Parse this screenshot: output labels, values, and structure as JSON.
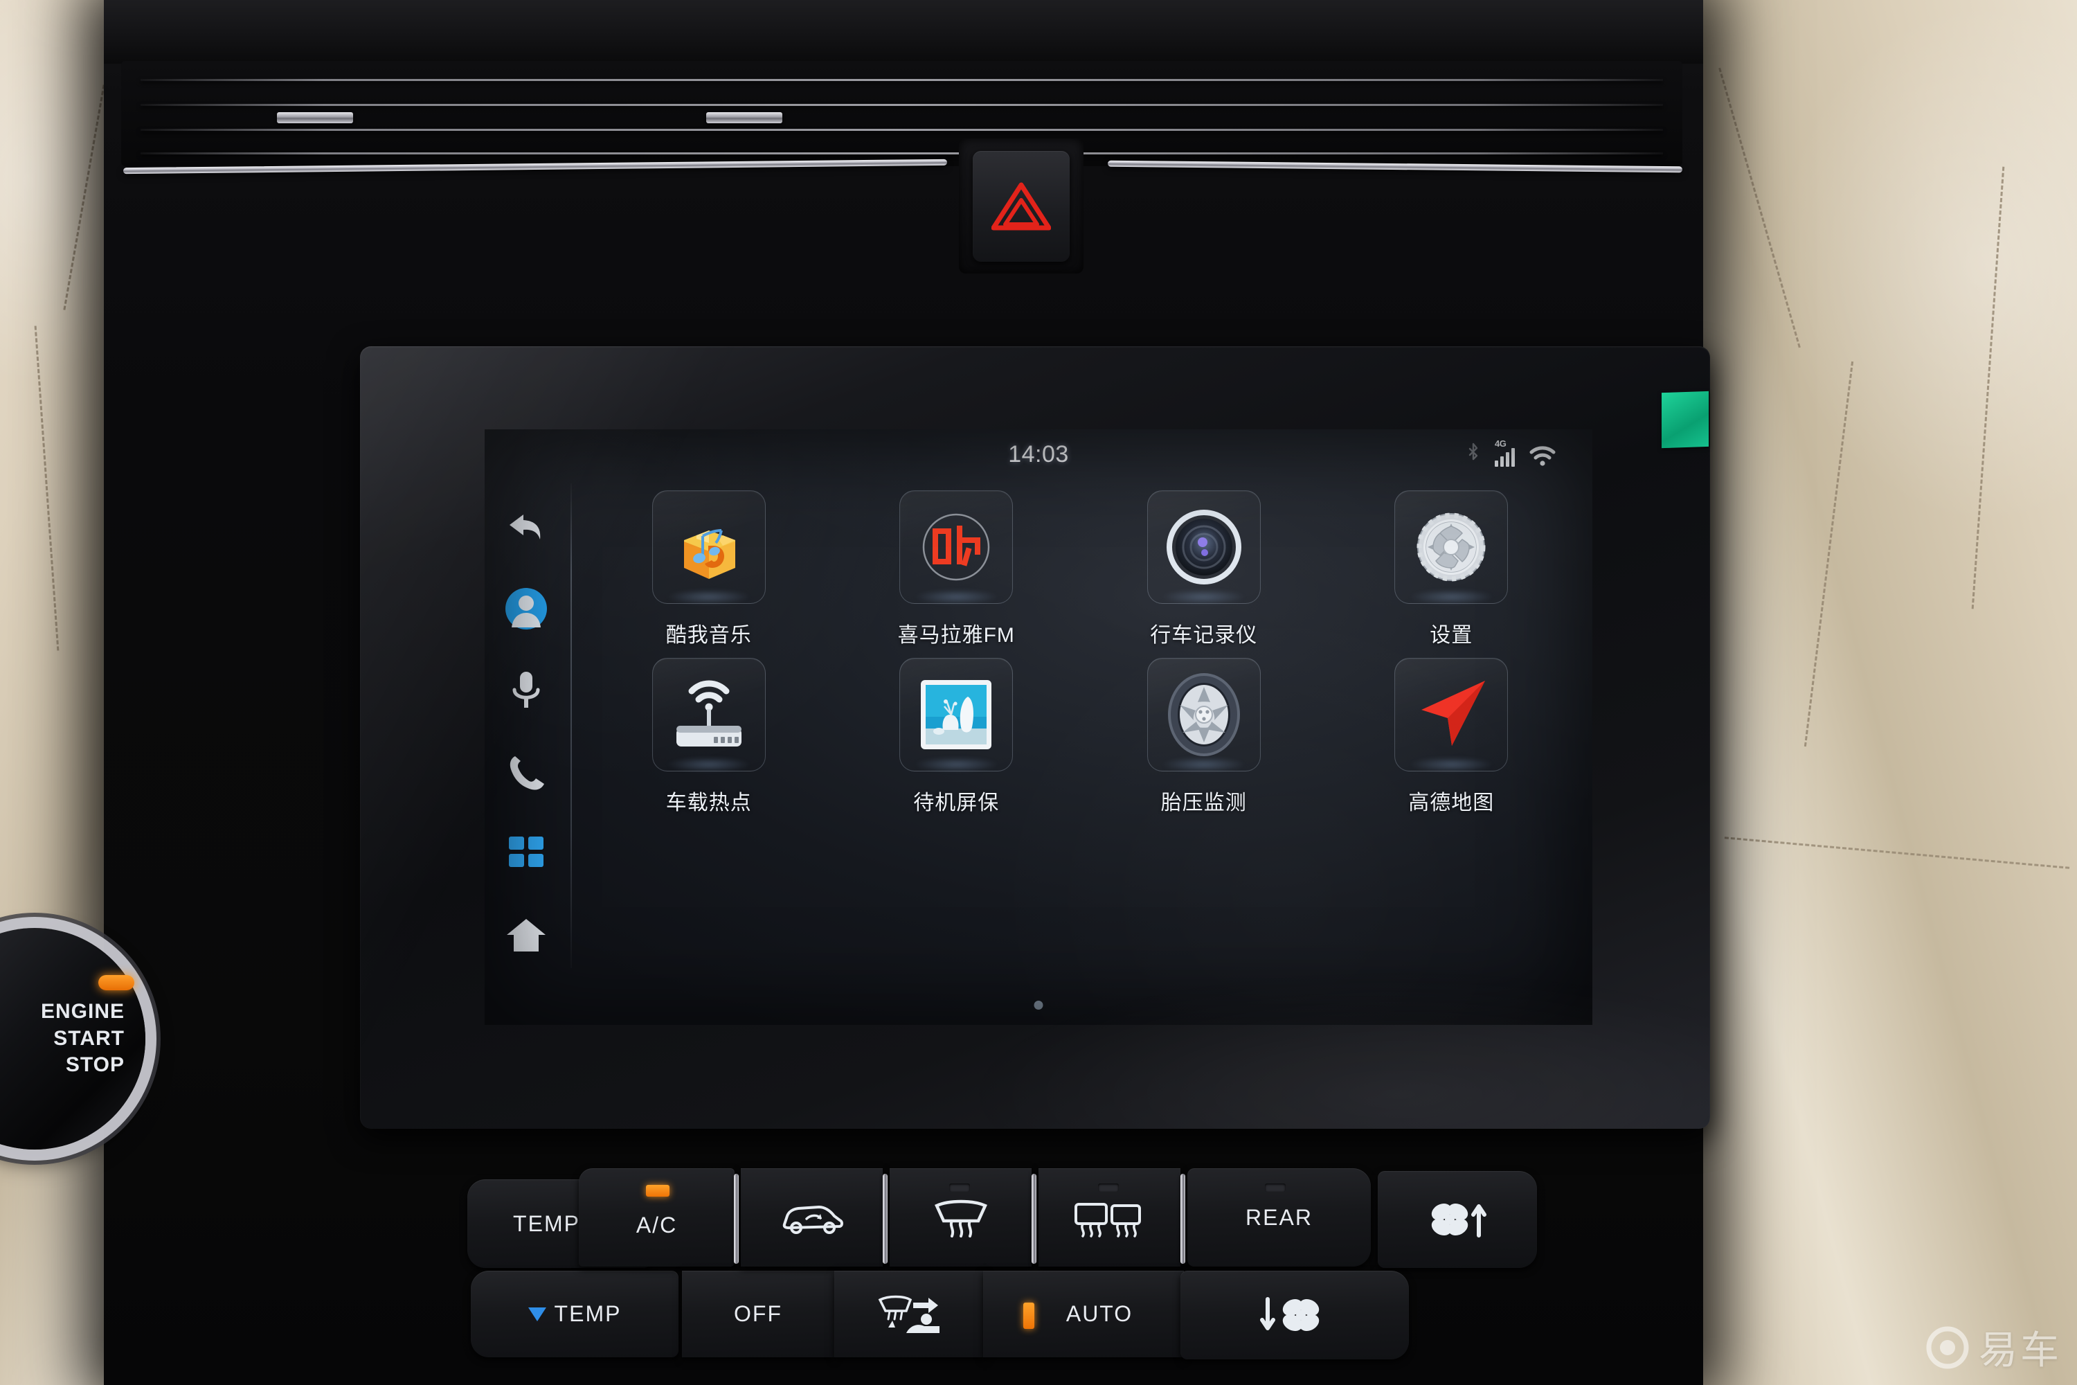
{
  "statusbar": {
    "time": "14:03",
    "icons": {
      "bluetooth": "bluetooth-icon",
      "signal": "signal-4g-icon",
      "signal_label": "4G",
      "wifi": "wifi-icon"
    }
  },
  "sidebar": {
    "items": [
      {
        "name": "back-icon",
        "label": "Back"
      },
      {
        "name": "user-avatar-icon",
        "label": "User"
      },
      {
        "name": "microphone-icon",
        "label": "Voice"
      },
      {
        "name": "phone-icon",
        "label": "Phone"
      },
      {
        "name": "apps-grid-icon",
        "label": "Apps"
      },
      {
        "name": "home-icon",
        "label": "Home"
      }
    ],
    "active_index": 4
  },
  "apps": [
    {
      "label": "酷我音乐",
      "icon": "kuwo-music-icon"
    },
    {
      "label": "喜马拉雅FM",
      "icon": "ximalaya-fm-icon",
      "glyph": "听"
    },
    {
      "label": "行车记录仪",
      "icon": "dashcam-lens-icon"
    },
    {
      "label": "设置",
      "icon": "settings-gear-icon"
    },
    {
      "label": "车载热点",
      "icon": "wifi-router-icon"
    },
    {
      "label": "待机屏保",
      "icon": "screensaver-photo-icon"
    },
    {
      "label": "胎压监测",
      "icon": "tire-pressure-icon"
    },
    {
      "label": "高德地图",
      "icon": "amap-navigation-arrow-icon"
    }
  ],
  "pager": {
    "pages": 1,
    "current": 1
  },
  "climate": {
    "temp_up": {
      "label": "TEMP",
      "icon": "arrow-up-red-icon"
    },
    "temp_down": {
      "label": "TEMP",
      "icon": "arrow-down-blue-icon"
    },
    "ac": {
      "label": "A/C",
      "led": "on"
    },
    "off": {
      "label": "OFF"
    },
    "recirculate": {
      "icon": "car-recirculation-icon"
    },
    "front_defrost": {
      "icon": "windshield-defrost-icon"
    },
    "foot_vent": {
      "icon": "seat-airflow-icon"
    },
    "rear_defrost": {
      "icon": "rear-window-defrost-icon"
    },
    "rear": {
      "label": "REAR"
    },
    "auto": {
      "label": "AUTO",
      "led": "on"
    },
    "fan_up": {
      "icon": "fan-increase-icon"
    },
    "fan_down": {
      "icon": "fan-decrease-icon"
    }
  },
  "hazard": {
    "icon": "hazard-triangle-icon"
  },
  "engine_button": {
    "line1": "ENGINE",
    "line2": "START",
    "line3": "STOP"
  },
  "watermark": {
    "text": "易车",
    "icon": "yiche-logo-icon"
  },
  "colors": {
    "accent_blue": "#1f9ae6",
    "led_orange": "#ef7406",
    "hazard_red": "#e2231a",
    "amap_red": "#ef3124",
    "kuwo_orange": "#f5a623",
    "screen_bg": "#1d2128"
  }
}
